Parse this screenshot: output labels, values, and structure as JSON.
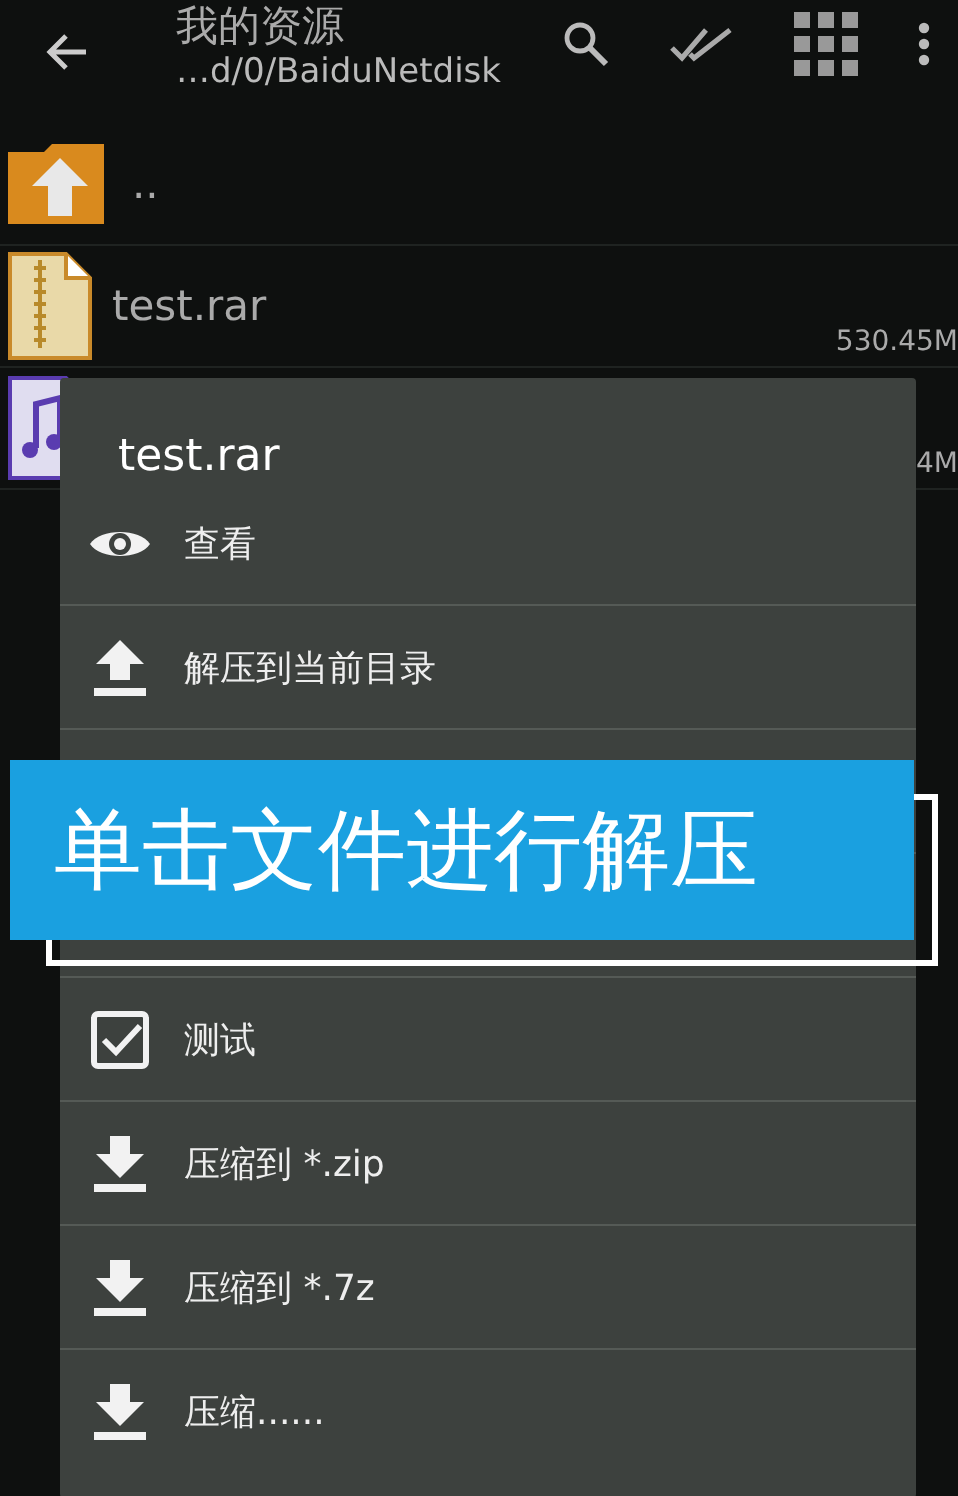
{
  "app_bar": {
    "title": "我的资源",
    "path": "…d/0/BaiduNetdisk"
  },
  "files": [
    {
      "kind": "parent",
      "name": ".."
    },
    {
      "kind": "archive",
      "name": "test.rar",
      "size": "530.45M"
    },
    {
      "kind": "audio",
      "size": "4M"
    }
  ],
  "dialog": {
    "title": "test.rar",
    "items": [
      {
        "kind": "view",
        "label": "查看"
      },
      {
        "kind": "extract",
        "label": "解压到当前目录"
      },
      {
        "kind": "covered"
      },
      {
        "kind": "covered"
      },
      {
        "kind": "test",
        "label": "测试"
      },
      {
        "kind": "compress",
        "label": "压缩到 *.zip"
      },
      {
        "kind": "compress",
        "label": "压缩到 *.7z"
      },
      {
        "kind": "compress",
        "label": "压缩......"
      }
    ]
  },
  "tip": {
    "text": "单击文件进行解压"
  }
}
